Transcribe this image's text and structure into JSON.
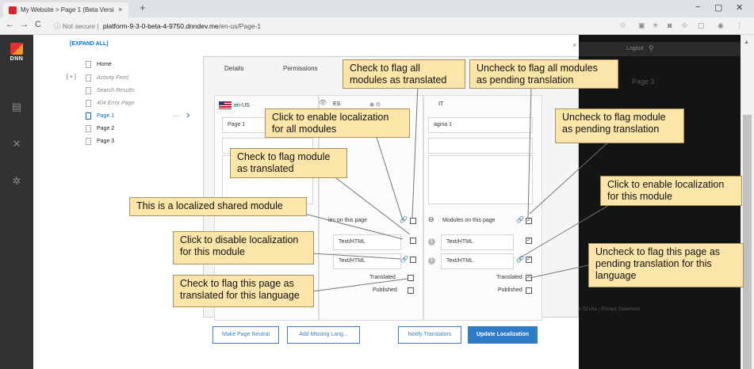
{
  "browser": {
    "tab_title": "My Website > Page 1 (Beta Versi",
    "tab_close": "×",
    "new_tab": "+",
    "window_controls": [
      "−",
      "▢",
      "✕"
    ],
    "nav": {
      "back": "←",
      "forward": "→",
      "reload": "C"
    },
    "url_info": "ⓘ Not secure  |",
    "url_domain": "platform-9-3-0-beta-4-9750.dnndev.me",
    "url_path": "/en-us/Page-1"
  },
  "sidebar": {
    "logo_text": "DNN",
    "icons": [
      "content-icon",
      "tools-icon",
      "settings-icon"
    ]
  },
  "tree": {
    "expand_all": "[EXPAND ALL]",
    "plus": "[ + ]",
    "items": [
      {
        "label": "Home",
        "state": "normal"
      },
      {
        "label": "Activity Feed",
        "state": "dim"
      },
      {
        "label": "Search Results",
        "state": "dim"
      },
      {
        "label": "404 Error Page",
        "state": "dim"
      },
      {
        "label": "Page 1",
        "state": "selected"
      },
      {
        "label": "Page 2",
        "state": "normal"
      },
      {
        "label": "Page 3",
        "state": "normal"
      }
    ]
  },
  "panel": {
    "tabs": [
      "Details",
      "Permissions"
    ],
    "languages": [
      {
        "code": "en-US",
        "page_name": "Page 1"
      },
      {
        "code": "ES",
        "page_name": ""
      },
      {
        "code": "IT",
        "page_name": "agina 1"
      }
    ],
    "modules_on_page": "Modules on this page",
    "modules_on_page_partial": "les on this page",
    "module_rows": [
      {
        "name": "Text/HTML"
      },
      {
        "name": "Text/HTML"
      }
    ],
    "translated_label": "Translated",
    "published_label": "Published",
    "buttons": {
      "make_neutral": "Make Page Neutral",
      "add_missing": "Add Missing Lang...",
      "notify": "Notify Translators",
      "update": "Update Localization"
    }
  },
  "preview": {
    "logout": "Logout",
    "page_label": "Page 3",
    "footer": "s Of Use  |  Privacy Statement",
    "close": "×"
  },
  "callouts": {
    "flag_all": "Check to flag all\nmodules as translated",
    "uncheck_all": "Uncheck to flag all modules\nas pending translation",
    "enable_all": "Click to enable localization\nfor all modules",
    "uncheck_module": "Uncheck to flag module\nas pending translation",
    "flag_module": "Check to flag module\nas translated",
    "enable_module": "Click to enable localization\nfor this module",
    "shared_module": "This is a localized shared module",
    "disable_module": "Click to disable localization\nfor this module",
    "uncheck_page": "Uncheck to flag this page as\npending translation for this\nlanguage",
    "flag_page": "Check to flag this page as\ntranslated for this language"
  },
  "colors": {
    "callout_bg": "#fbe5a8",
    "accent": "#2f7cc6",
    "sidebar": "#323232"
  }
}
